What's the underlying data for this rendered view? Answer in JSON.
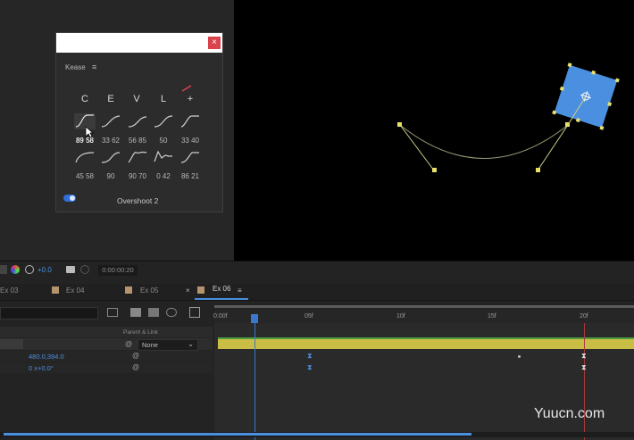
{
  "kease": {
    "title": "Kease",
    "menu_icon": "≡",
    "close_label": "×",
    "headers": [
      "C",
      "E",
      "V",
      "L",
      "+"
    ],
    "row1_values": [
      "89 58",
      "33 62",
      "56 85",
      "50",
      "33 40"
    ],
    "row2_values": [
      "45 58",
      "90",
      "90 70",
      "0 42",
      "86 21"
    ],
    "status": "Overshoot 2"
  },
  "timeline": {
    "exposure": "+0.0",
    "timecode": "0:00:00:20",
    "tabs": [
      "Ex 03",
      "Ex 04",
      "Ex 05",
      "Ex 06"
    ],
    "tab_close": "×",
    "tab_menu": "≡",
    "parent_link": "Parent & Link",
    "parent_value": "None",
    "position_value": "480.0,394.0",
    "rotation_value": "0 x+0.0°",
    "ruler": [
      "0:00f",
      "05f",
      "10f",
      "15f",
      "20f"
    ]
  },
  "watermark": "Yuucn.com"
}
